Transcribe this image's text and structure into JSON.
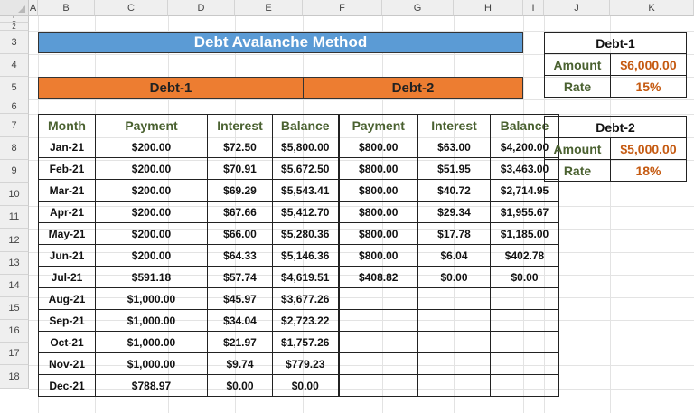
{
  "columns": [
    "A",
    "B",
    "C",
    "D",
    "E",
    "F",
    "G",
    "H",
    "I",
    "J",
    "K"
  ],
  "rows": [
    "1",
    "2",
    "3",
    "4",
    "5",
    "6",
    "7",
    "8",
    "9",
    "10",
    "11",
    "12",
    "13",
    "14",
    "15",
    "16",
    "17",
    "18"
  ],
  "title": "Debt Avalanche Method",
  "groups": [
    "Debt-1",
    "Debt-2"
  ],
  "headers": [
    "Month",
    "Payment",
    "Interest",
    "Balance",
    "Payment",
    "Interest",
    "Balance"
  ],
  "schedule": [
    [
      "Jan-21",
      "$200.00",
      "$72.50",
      "$5,800.00",
      "$800.00",
      "$63.00",
      "$4,200.00"
    ],
    [
      "Feb-21",
      "$200.00",
      "$70.91",
      "$5,672.50",
      "$800.00",
      "$51.95",
      "$3,463.00"
    ],
    [
      "Mar-21",
      "$200.00",
      "$69.29",
      "$5,543.41",
      "$800.00",
      "$40.72",
      "$2,714.95"
    ],
    [
      "Apr-21",
      "$200.00",
      "$67.66",
      "$5,412.70",
      "$800.00",
      "$29.34",
      "$1,955.67"
    ],
    [
      "May-21",
      "$200.00",
      "$66.00",
      "$5,280.36",
      "$800.00",
      "$17.78",
      "$1,185.00"
    ],
    [
      "Jun-21",
      "$200.00",
      "$64.33",
      "$5,146.36",
      "$800.00",
      "$6.04",
      "$402.78"
    ],
    [
      "Jul-21",
      "$591.18",
      "$57.74",
      "$4,619.51",
      "$408.82",
      "$0.00",
      "$0.00"
    ],
    [
      "Aug-21",
      "$1,000.00",
      "$45.97",
      "$3,677.26",
      "",
      "",
      ""
    ],
    [
      "Sep-21",
      "$1,000.00",
      "$34.04",
      "$2,723.22",
      "",
      "",
      ""
    ],
    [
      "Oct-21",
      "$1,000.00",
      "$21.97",
      "$1,757.26",
      "",
      "",
      ""
    ],
    [
      "Nov-21",
      "$1,000.00",
      "$9.74",
      "$779.23",
      "",
      "",
      ""
    ],
    [
      "Dec-21",
      "$788.97",
      "$0.00",
      "$0.00",
      "",
      "",
      ""
    ]
  ],
  "debt1": {
    "title": "Debt-1",
    "amount_label": "Amount",
    "amount": "$6,000.00",
    "rate_label": "Rate",
    "rate": "15%"
  },
  "debt2": {
    "title": "Debt-2",
    "amount_label": "Amount",
    "amount": "$5,000.00",
    "rate_label": "Rate",
    "rate": "18%"
  }
}
